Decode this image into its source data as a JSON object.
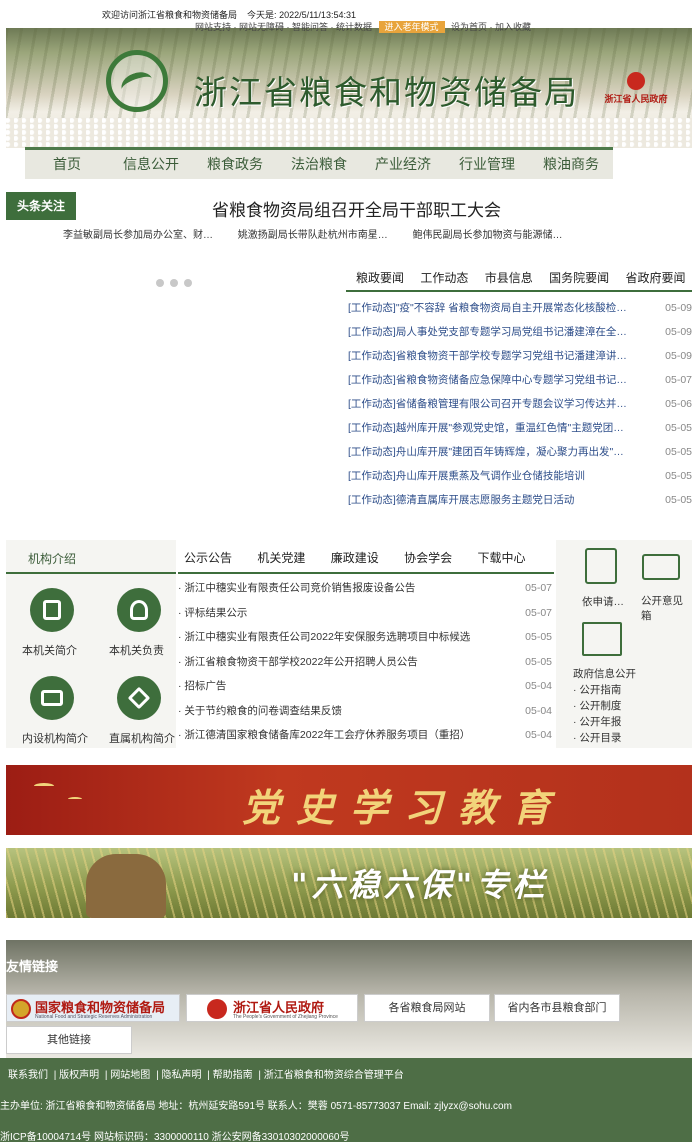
{
  "topbar": {
    "welcome": "欢迎访问浙江省粮食和物资储备局",
    "today_label": "今天是:",
    "datetime": "2022/5/11/13:54:31",
    "links_text": "网站支持 · 网站无障碍 · 智能问答 · 统计数据",
    "highlight": "进入老年模式",
    "links_tail": "设为首页 · 加入收藏"
  },
  "banner": {
    "site_name": "浙江省粮食和物资储备局",
    "gov_label": "浙江省人民政府"
  },
  "nav": [
    "首页",
    "信息公开",
    "粮食政务",
    "法治粮食",
    "产业经济",
    "行业管理",
    "粮油商务"
  ],
  "headline": {
    "tag": "头条关注",
    "title": "省粮食物资局组召开全局干部职工大会",
    "subs": [
      "李益敏副局长参加局办公室、财…",
      "姚激扬副局长带队赴杭州市南星…",
      "鲍伟民副局长参加物资与能源储…"
    ]
  },
  "news": {
    "tabs": [
      "粮政要闻",
      "工作动态",
      "市县信息",
      "国务院要闻",
      "省政府要闻"
    ],
    "items": [
      {
        "title": "[工作动态]\"疫\"不容辞 省粮食物资局自主开展常态化核酸检…",
        "date": "05-09"
      },
      {
        "title": "[工作动态]局人事处党支部专题学习局党组书记潘建漳在全…",
        "date": "05-09"
      },
      {
        "title": "[工作动态]省粮食物资干部学校专题学习党组书记潘建漳讲…",
        "date": "05-09"
      },
      {
        "title": "[工作动态]省粮食物资储备应急保障中心专题学习党组书记…",
        "date": "05-07"
      },
      {
        "title": "[工作动态]省储备粮管理有限公司召开专题会议学习传达并…",
        "date": "05-06"
      },
      {
        "title": "[工作动态]越州库开展\"参观党史馆，重温红色情\"主题党团…",
        "date": "05-05"
      },
      {
        "title": "[工作动态]舟山库开展\"建团百年铸辉煌，凝心聚力再出发\"…",
        "date": "05-05"
      },
      {
        "title": "[工作动态]舟山库开展熏蒸及气调作业仓储技能培训",
        "date": "05-05"
      },
      {
        "title": "[工作动态]德清直属库开展志愿服务主题党日活动",
        "date": "05-05"
      }
    ]
  },
  "org": {
    "title": "机构介绍",
    "items": [
      "本机关简介",
      "本机关负责",
      "内设机构简介",
      "直属机构简介"
    ]
  },
  "notices": {
    "tabs": [
      "公示公告",
      "机关党建",
      "廉政建设",
      "协会学会",
      "下载中心"
    ],
    "items": [
      {
        "title": "浙江中穗实业有限责任公司竞价销售报废设备公告",
        "date": "05-07"
      },
      {
        "title": "评标结果公示",
        "date": "05-07"
      },
      {
        "title": "浙江中穗实业有限责任公司2022年安保服务选聘项目中标候选",
        "date": "05-05"
      },
      {
        "title": "浙江省粮食物资干部学校2022年公开招聘人员公告",
        "date": "05-05"
      },
      {
        "title": "招标广告",
        "date": "05-04"
      },
      {
        "title": "关于节约粮食的问卷调查结果反馈",
        "date": "05-04"
      },
      {
        "title": "浙江德清国家粮食储备库2022年工会疗休养服务项目（重招）",
        "date": "05-04"
      }
    ]
  },
  "info": {
    "apply": "依申请…",
    "opinion": "公开意见箱",
    "gov_open": "政府信息公开",
    "subs": [
      "· 公开指南",
      "· 公开制度",
      "· 公开年报",
      "· 公开目录"
    ]
  },
  "banners": {
    "party": "党史学习教育",
    "six": "\"六稳六保\"专栏"
  },
  "links": {
    "title": "友情链接",
    "guo_name": "国家粮食和物资储备局",
    "guo_en": "National Food and Strategic Reserves Administration",
    "zj_name": "浙江省人民政府",
    "zj_en": "The People's Government of Zhejiang Province",
    "province": "各省粮食局网站",
    "city": "省内各市县粮食部门",
    "other": "其他链接"
  },
  "footer": {
    "links": [
      "联系我们",
      "版权声明",
      "网站地图",
      "隐私声明",
      "帮助指南",
      "浙江省粮食和物资综合管理平台"
    ],
    "host": "主办单位: 浙江省粮食和物资储备局 地址：杭州延安路591号 联系人：樊蓉 0571-85773037 Email: zjlyzx@sohu.com",
    "icp": "浙ICP备10004714号 网站标识码：3300000110 浙公安网备33010302000060号"
  },
  "colors": {
    "primary": "#3e6e3c",
    "link": "#2e4e8a",
    "party_red": "#b3311c",
    "gold": "#f2d47a"
  }
}
